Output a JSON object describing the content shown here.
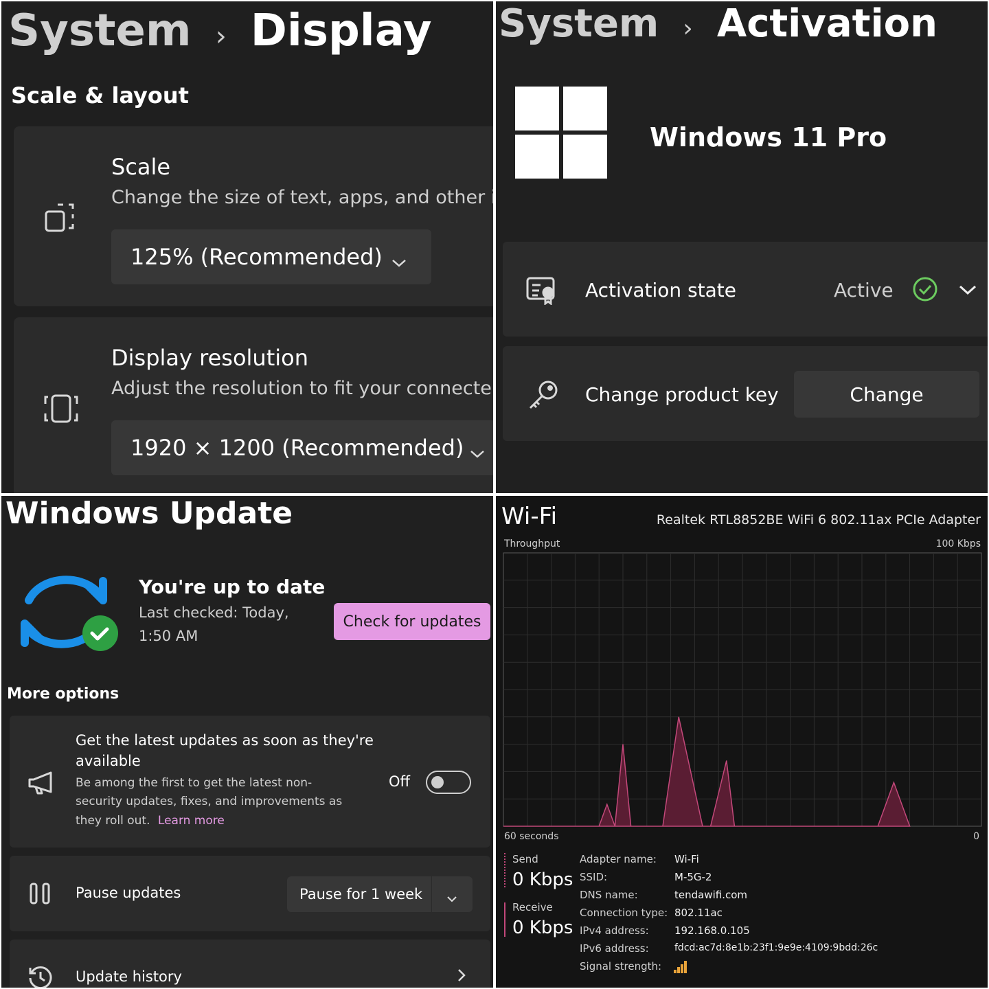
{
  "display": {
    "breadcrumb_root": "System",
    "breadcrumb_sep": "›",
    "breadcrumb_page": "Display",
    "section_title": "Scale & layout",
    "scale": {
      "title": "Scale",
      "description": "Change the size of text, apps, and other it",
      "value": "125% (Recommended)"
    },
    "resolution": {
      "title": "Display resolution",
      "description": "Adjust the resolution to fit your connecte",
      "value": "1920 × 1200 (Recommended)"
    }
  },
  "activation": {
    "breadcrumb_root": "System",
    "breadcrumb_sep": "›",
    "breadcrumb_page": "Activation",
    "edition": "Windows 11 Pro",
    "state_label": "Activation state",
    "state_value": "Active",
    "product_key_label": "Change product key",
    "change_button": "Change"
  },
  "update": {
    "title": "Windows Update",
    "status_title": "You're up to date",
    "last_checked_line1": "Last checked: Today,",
    "last_checked_line2": "1:50 AM",
    "check_button": "Check for updates",
    "more_options": "More options",
    "latest": {
      "title_line1": "Get the latest updates as soon as they're",
      "title_line2": "available",
      "desc_line1": "Be among the first to get the latest non-",
      "desc_line2": "security updates, fixes, and improvements as",
      "desc_line3": "they roll out.",
      "learn_more": "Learn more",
      "toggle_label": "Off"
    },
    "pause": {
      "label": "Pause updates",
      "value": "Pause for 1 week"
    },
    "history": {
      "label": "Update history"
    },
    "accent_color": "#e49ae3"
  },
  "wifi": {
    "title": "Wi-Fi",
    "adapter_full": "Realtek RTL8852BE WiFi 6 802.11ax PCIe Adapter",
    "throughput_label": "Throughput",
    "max_label": "100 Kbps",
    "time_label": "60 seconds",
    "zero_label": "0",
    "send_label": "Send",
    "send_value": "0 Kbps",
    "receive_label": "Receive",
    "receive_value": "0 Kbps",
    "details": [
      {
        "label": "Adapter name:",
        "value": "Wi-Fi"
      },
      {
        "label": "SSID:",
        "value": "M-5G-2"
      },
      {
        "label": "DNS name:",
        "value": "tendawifi.com"
      },
      {
        "label": "Connection type:",
        "value": "802.11ac"
      },
      {
        "label": "IPv4 address:",
        "value": "192.168.0.105"
      },
      {
        "label": "IPv6 address:",
        "value": "fdcd:ac7d:8e1b:23f1:9e9e:4109:9bdd:26c"
      },
      {
        "label": "Signal strength:",
        "value": ""
      }
    ],
    "graph_color": "#c2487a"
  },
  "chart_data": {
    "type": "area",
    "x": [
      0,
      5,
      9,
      12,
      13,
      14,
      15,
      16,
      20,
      22,
      25,
      26,
      28,
      29,
      45,
      47,
      49,
      51
    ],
    "series": [
      {
        "values": [
          0,
          0,
          0,
          0,
          8,
          0,
          30,
          0,
          0,
          40,
          0,
          0,
          24,
          0,
          0,
          0,
          16,
          0
        ]
      }
    ],
    "xlabel": "60 seconds",
    "ylabel": "Throughput",
    "xlim": [
      0,
      60
    ],
    "ylim": [
      0,
      100
    ],
    "grid": true
  }
}
